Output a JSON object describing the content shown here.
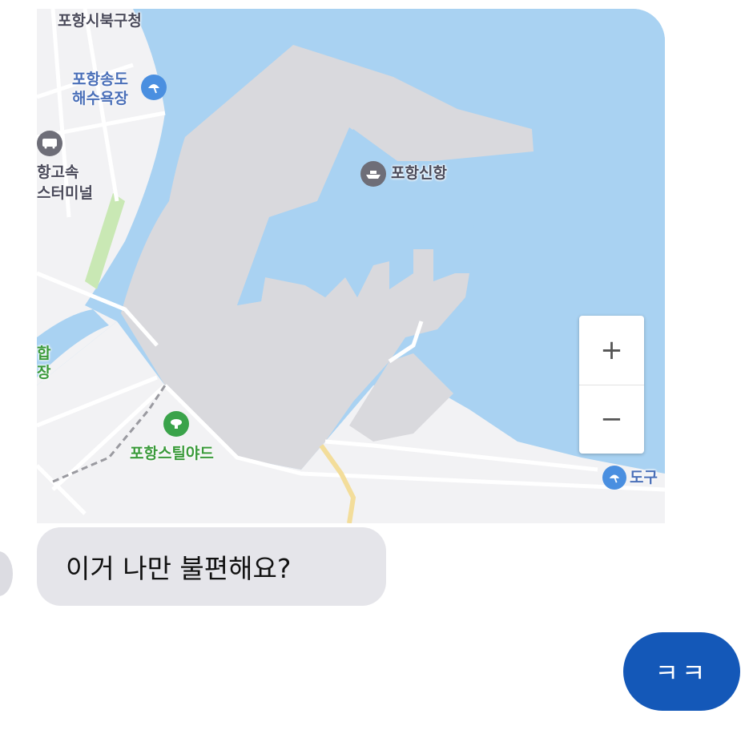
{
  "map": {
    "labels": {
      "buk_gu_office": "포항시북구청",
      "songdo_beach_line1": "포항송도",
      "songdo_beach_line2": "해수욕장",
      "bus_terminal_line1": "항고속",
      "bus_terminal_line2": "스터미널",
      "new_port": "포항신항",
      "steel_yard": "포항스틸야드",
      "left_edge_line1": "합",
      "left_edge_line2": "장",
      "dogu_beach": "도구"
    },
    "icons": {
      "beach": "beach-umbrella-icon",
      "bus": "bus-icon",
      "port": "ship-icon",
      "stadium": "stadium-icon"
    },
    "colors": {
      "water": "#a9d2f2",
      "land": "#f2f2f4",
      "port_area": "#d9d9dd",
      "park": "#c9e8b4",
      "road_yellow": "#f3dd9a",
      "poi_blue": "#4a8fe0",
      "poi_green": "#3aa34a"
    },
    "zoom": {
      "in_label": "+",
      "out_label": "−"
    }
  },
  "chat": {
    "incoming_message": "이거 나만 불편해요?",
    "outgoing_message": "ㅋㅋ",
    "incoming_bubble_color": "#e5e5ea",
    "outgoing_bubble_color": "#1458b8"
  }
}
